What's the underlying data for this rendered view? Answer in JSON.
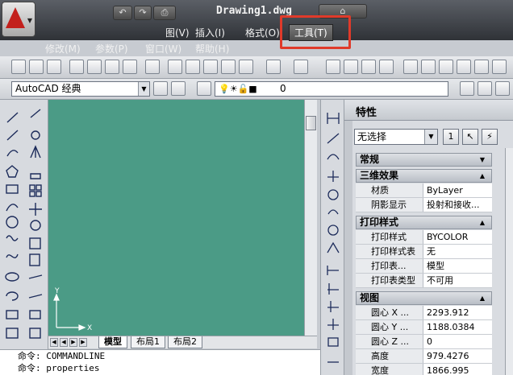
{
  "window": {
    "title": "Drawing1.dwg"
  },
  "quick_access": {
    "redo": "↷",
    "print": "⎙"
  },
  "menus": [
    {
      "label": "图(V)"
    },
    {
      "label": "插入(I)"
    },
    {
      "label": "格式(O)"
    },
    {
      "label": "工具(T)"
    },
    {
      "label": "修改(M)"
    },
    {
      "label": "参数(P)"
    },
    {
      "label": "窗口(W)"
    },
    {
      "label": "帮助(H)"
    }
  ],
  "toolbar2": {
    "workspace": "AutoCAD 经典",
    "layer": "0"
  },
  "model_tabs": [
    "模型",
    "布局1",
    "布局2"
  ],
  "command_lines": [
    "命令: COMMANDLINE",
    "命令: properties"
  ],
  "properties": {
    "title": "特性",
    "selection": "无选择",
    "button_1": "1",
    "sections": [
      {
        "name": "常规",
        "rows": []
      },
      {
        "name": "三维效果",
        "rows": [
          {
            "key": "材质",
            "value": "ByLayer"
          },
          {
            "key": "阴影显示",
            "value": "投射和接收..."
          }
        ]
      },
      {
        "name": "打印样式",
        "rows": [
          {
            "key": "打印样式",
            "value": "BYCOLOR"
          },
          {
            "key": "打印样式表",
            "value": "无"
          },
          {
            "key": "打印表...",
            "value": "模型"
          },
          {
            "key": "打印表类型",
            "value": "不可用"
          }
        ]
      },
      {
        "name": "视图",
        "rows": [
          {
            "key": "圆心 X ...",
            "value": "2293.912"
          },
          {
            "key": "圆心 Y ...",
            "value": "1188.0384"
          },
          {
            "key": "圆心 Z ...",
            "value": "0"
          },
          {
            "key": "高度",
            "value": "979.4276"
          },
          {
            "key": "宽度",
            "value": "1866.995"
          }
        ]
      }
    ]
  },
  "ucs": {
    "x_label": "X",
    "y_label": "Y"
  },
  "colors": {
    "canvas": "#4b9b86",
    "highlight_box": "#e03a2a"
  }
}
